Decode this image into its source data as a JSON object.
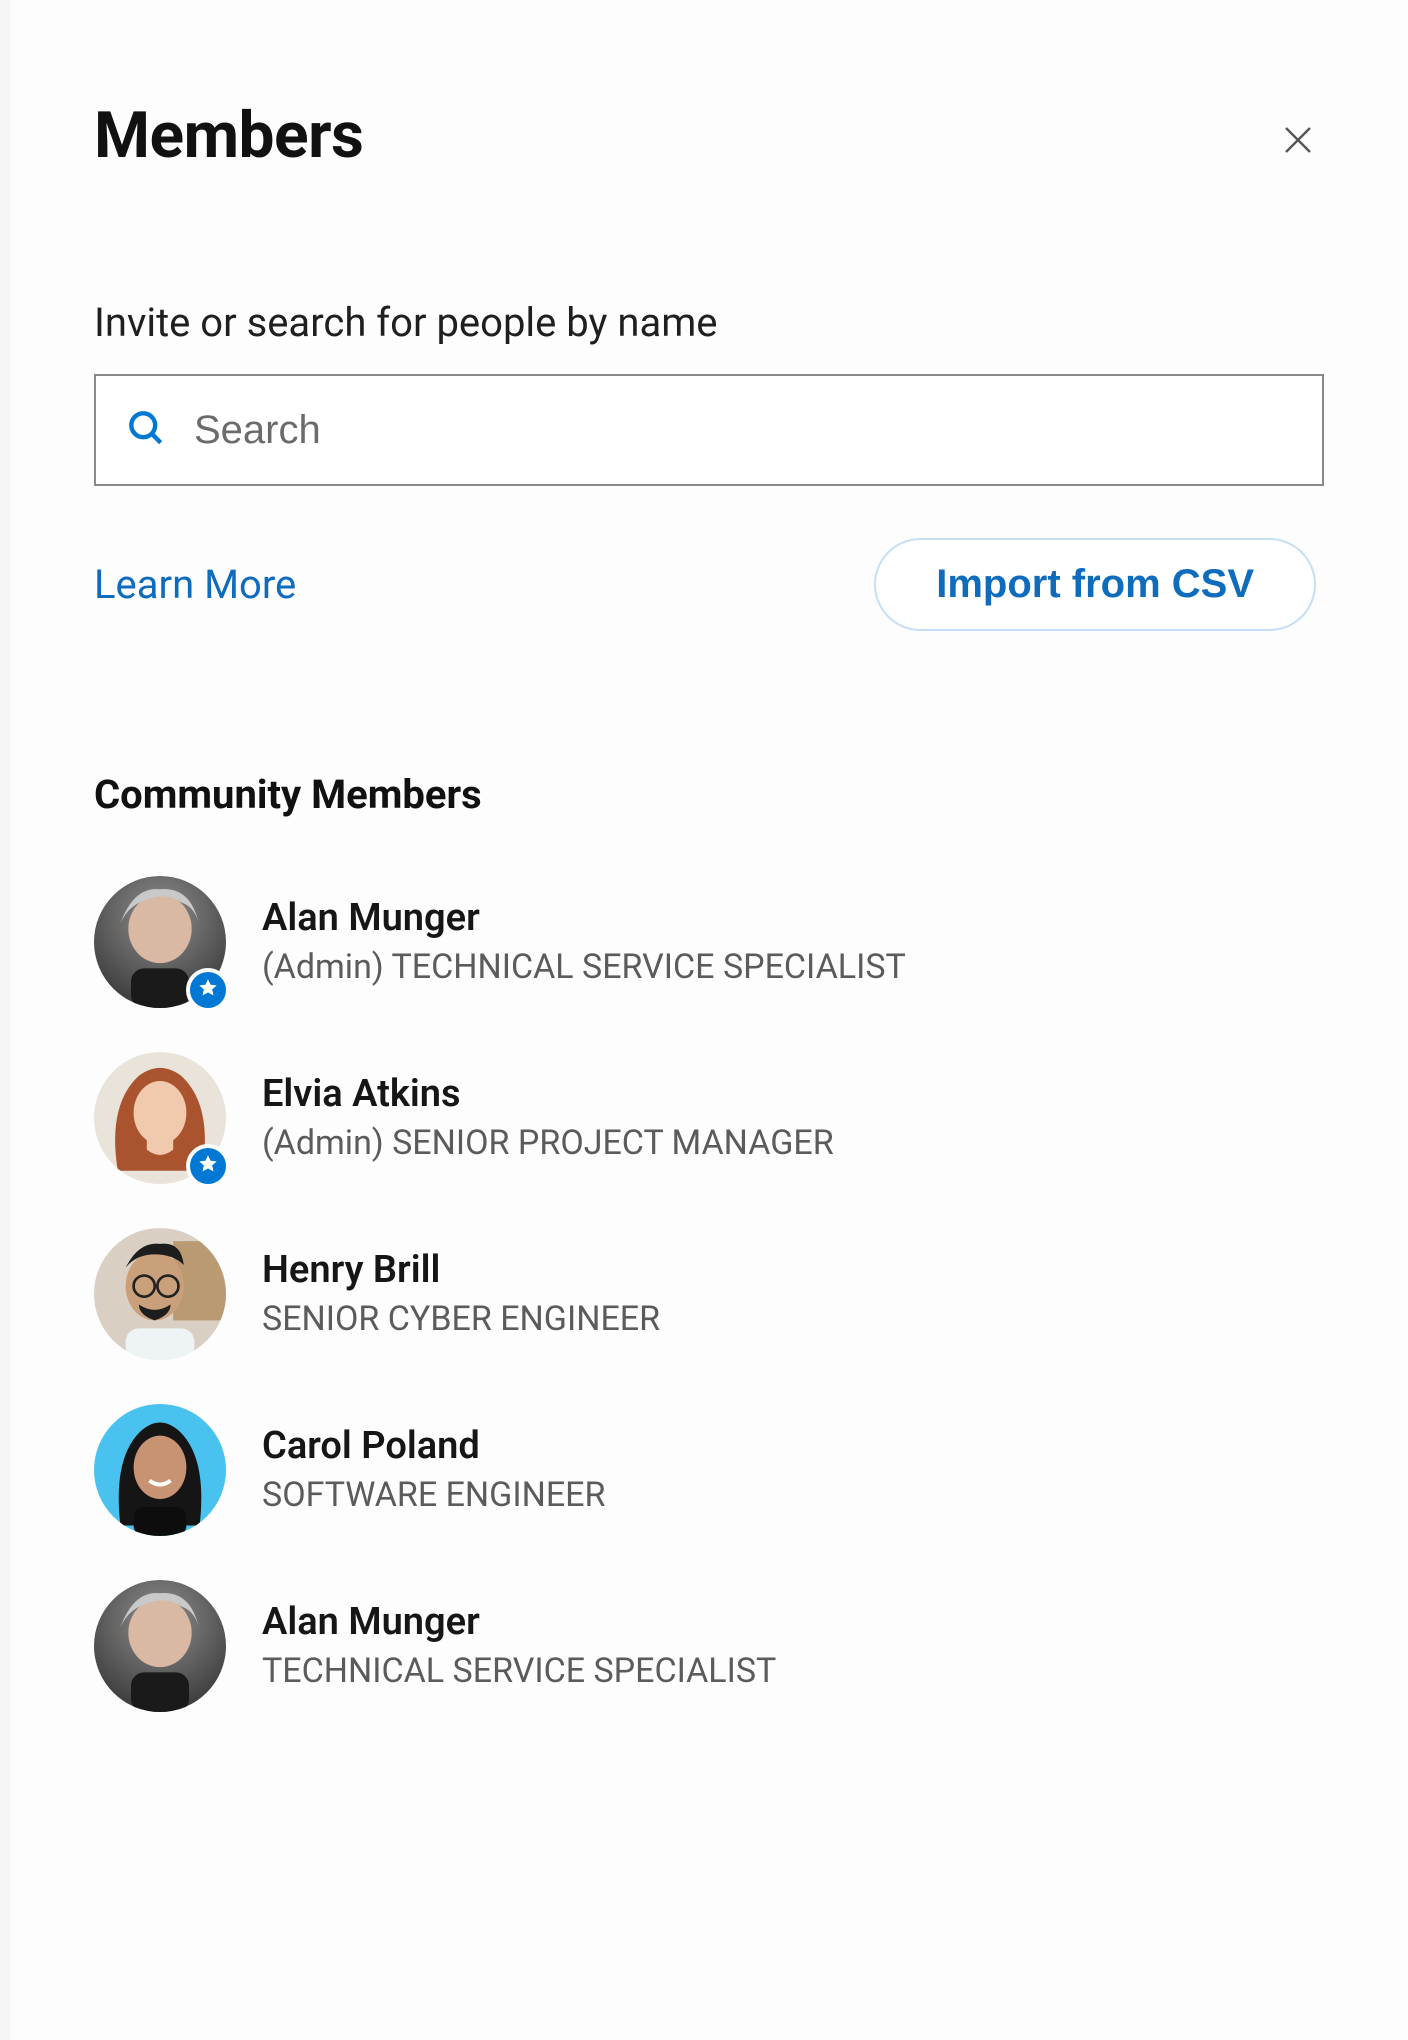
{
  "header": {
    "title": "Members"
  },
  "search": {
    "label": "Invite or search for people by name",
    "placeholder": "Search"
  },
  "actions": {
    "learn_more": "Learn More",
    "import_csv": "Import from CSV"
  },
  "section": {
    "title": "Community Members"
  },
  "members": [
    {
      "name": "Alan Munger",
      "role": "(Admin) TECHNICAL SERVICE SPECIALIST",
      "is_admin": true,
      "avatar_kind": "alan"
    },
    {
      "name": "Elvia Atkins",
      "role": "(Admin) SENIOR PROJECT MANAGER",
      "is_admin": true,
      "avatar_kind": "elvia"
    },
    {
      "name": "Henry Brill",
      "role": "SENIOR CYBER ENGINEER",
      "is_admin": false,
      "avatar_kind": "henry"
    },
    {
      "name": "Carol Poland",
      "role": "SOFTWARE ENGINEER",
      "is_admin": false,
      "avatar_kind": "carol"
    },
    {
      "name": "Alan Munger",
      "role": "TECHNICAL SERVICE SPECIALIST",
      "is_admin": false,
      "avatar_kind": "alan"
    }
  ],
  "colors": {
    "accent": "#0078d4",
    "link": "#0f6cbd"
  }
}
